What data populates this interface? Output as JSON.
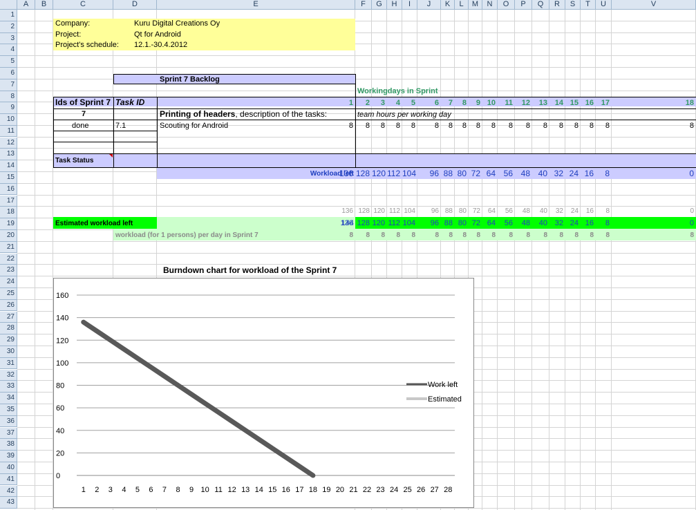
{
  "columns": [
    "A",
    "B",
    "C",
    "D",
    "E",
    "F",
    "G",
    "H",
    "I",
    "J",
    "K",
    "L",
    "M",
    "N",
    "O",
    "P",
    "Q",
    "R",
    "S",
    "T",
    "U",
    "V"
  ],
  "rows": [
    "1",
    "2",
    "3",
    "4",
    "5",
    "6",
    "7",
    "8",
    "9",
    "10",
    "11",
    "12",
    "13",
    "14",
    "15",
    "16",
    "17",
    "18",
    "19",
    "20",
    "21",
    "22",
    "23",
    "24",
    "25",
    "26",
    "27",
    "28",
    "29",
    "30",
    "31",
    "32",
    "33",
    "34",
    "35",
    "36",
    "37",
    "38",
    "39",
    "40",
    "41",
    "42",
    "43"
  ],
  "colors": {
    "header_bg": "#dbe5f1",
    "info_yellow": "#ffff99",
    "lavender": "#ccccff",
    "bright_green": "#00ff00",
    "pale_green": "#ccffcc",
    "teal_text": "#339966",
    "blue_text": "#1f3fbf",
    "grey_text": "#9a9a9a",
    "work_left_line": "#595959",
    "estimated_line": "#c8c8c8"
  },
  "info": {
    "company_label": "Company:",
    "company_value": "Kuru Digital Creations Oy",
    "project_label": "Project:",
    "project_value": "Qt for Android",
    "schedule_label": "Project's schedule:",
    "schedule_value": "12.1.-30.4.2012"
  },
  "backlog": {
    "title": "Sprint 7 Backlog",
    "workingdays_label": "Workingdays in Sprint",
    "day_numbers": [
      "1",
      "2",
      "3",
      "4",
      "5",
      "6",
      "7",
      "8",
      "9",
      "10",
      "11",
      "12",
      "13",
      "14",
      "15",
      "16",
      "17",
      "18"
    ],
    "ids_header": "Ids of Sprint 7",
    "taskid_header": "Task ID",
    "sprint_number": "7",
    "headers_bold": "Printing of headers",
    "headers_rest": ", description of the tasks:",
    "team_hours": "team hours per working day",
    "task_status_done": "done",
    "task_id": "7.1",
    "task_desc": "Scouting for Android",
    "task_hours": [
      "8",
      "8",
      "8",
      "8",
      "8",
      "8",
      "8",
      "8",
      "8",
      "8",
      "8",
      "8",
      "8",
      "8",
      "8",
      "8",
      "8",
      "8"
    ],
    "task_status_label": "Task Status",
    "workload_left_label": "Workload left",
    "workload_left": [
      "136",
      "128",
      "120",
      "112",
      "104",
      "96",
      "88",
      "80",
      "72",
      "64",
      "56",
      "48",
      "40",
      "32",
      "24",
      "16",
      "8",
      "0"
    ],
    "row17_values": [
      "136",
      "128",
      "120",
      "112",
      "104",
      "96",
      "88",
      "80",
      "72",
      "64",
      "56",
      "48",
      "40",
      "32",
      "24",
      "16",
      "8",
      "0"
    ],
    "estimated_label": "Estimated workload left",
    "estimated_total": "144",
    "estimated_values": [
      "136",
      "128",
      "120",
      "112",
      "104",
      "96",
      "88",
      "80",
      "72",
      "64",
      "56",
      "48",
      "40",
      "32",
      "24",
      "16",
      "8",
      "0"
    ],
    "per_day_label": "workload (for  1 persons) per day in Sprint 7",
    "per_day_values": [
      "8",
      "8",
      "8",
      "8",
      "8",
      "8",
      "8",
      "8",
      "8",
      "8",
      "8",
      "8",
      "8",
      "8",
      "8",
      "8",
      "8",
      "8"
    ]
  },
  "chart_data": {
    "type": "line",
    "title": "Burndown chart for workload of the Sprint 7",
    "x": [
      1,
      2,
      3,
      4,
      5,
      6,
      7,
      8,
      9,
      10,
      11,
      12,
      13,
      14,
      15,
      16,
      17,
      18,
      19,
      20,
      21,
      22,
      23,
      24,
      25,
      26,
      27,
      28
    ],
    "x_labels": [
      "1",
      "2",
      "3",
      "4",
      "5",
      "6",
      "7",
      "8",
      "9",
      "10",
      "11",
      "12",
      "13",
      "14",
      "15",
      "16",
      "17",
      "18",
      "19",
      "20",
      "21",
      "22",
      "23",
      "24",
      "25",
      "26",
      "27",
      "28"
    ],
    "y_ticks": [
      "0",
      "20",
      "40",
      "60",
      "80",
      "100",
      "120",
      "140",
      "160"
    ],
    "ylim": [
      0,
      160
    ],
    "grid": true,
    "legend_position": "right",
    "series": [
      {
        "name": "Work left",
        "color": "#595959",
        "values": [
          136,
          128,
          120,
          112,
          104,
          96,
          88,
          80,
          72,
          64,
          56,
          48,
          40,
          32,
          24,
          16,
          8,
          0
        ]
      },
      {
        "name": "Estimated",
        "color": "#c8c8c8",
        "values": [
          136,
          128,
          120,
          112,
          104,
          96,
          88,
          80,
          72,
          64,
          56,
          48,
          40,
          32,
          24,
          16,
          8,
          0
        ]
      }
    ]
  }
}
